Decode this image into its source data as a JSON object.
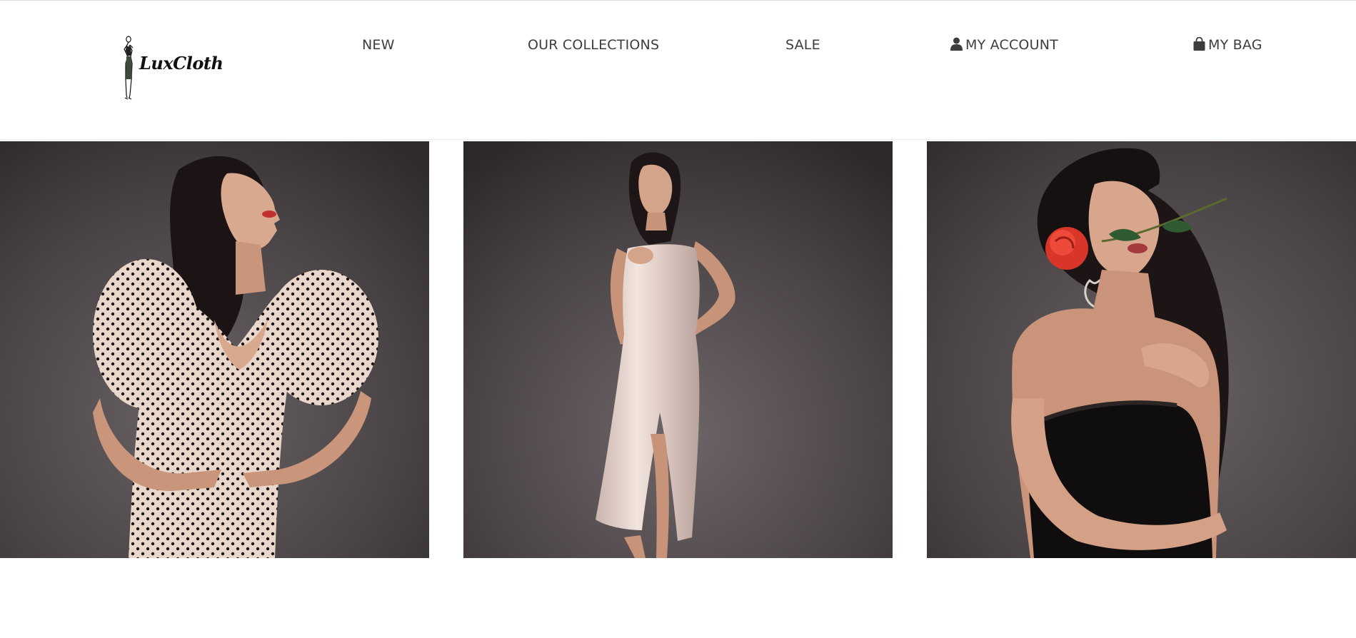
{
  "brand": {
    "name": "LuxCloth"
  },
  "nav": {
    "items": [
      {
        "label": "NEW"
      },
      {
        "label": "OUR COLLECTIONS"
      },
      {
        "label": "SALE"
      },
      {
        "label": "MY ACCOUNT",
        "icon": "user-icon"
      },
      {
        "label": "MY BAG",
        "icon": "shopping-bag-icon"
      }
    ]
  },
  "gallery": {
    "tiles": [
      {
        "image": "model-polka-dot-dress-photo"
      },
      {
        "image": "model-satin-slip-dress-photo"
      },
      {
        "image": "model-rose-black-lace-photo"
      }
    ]
  },
  "colors": {
    "nav_text": "#3d3d3d",
    "background": "#ffffff",
    "photo_backdrop": "#3e3a3b"
  }
}
